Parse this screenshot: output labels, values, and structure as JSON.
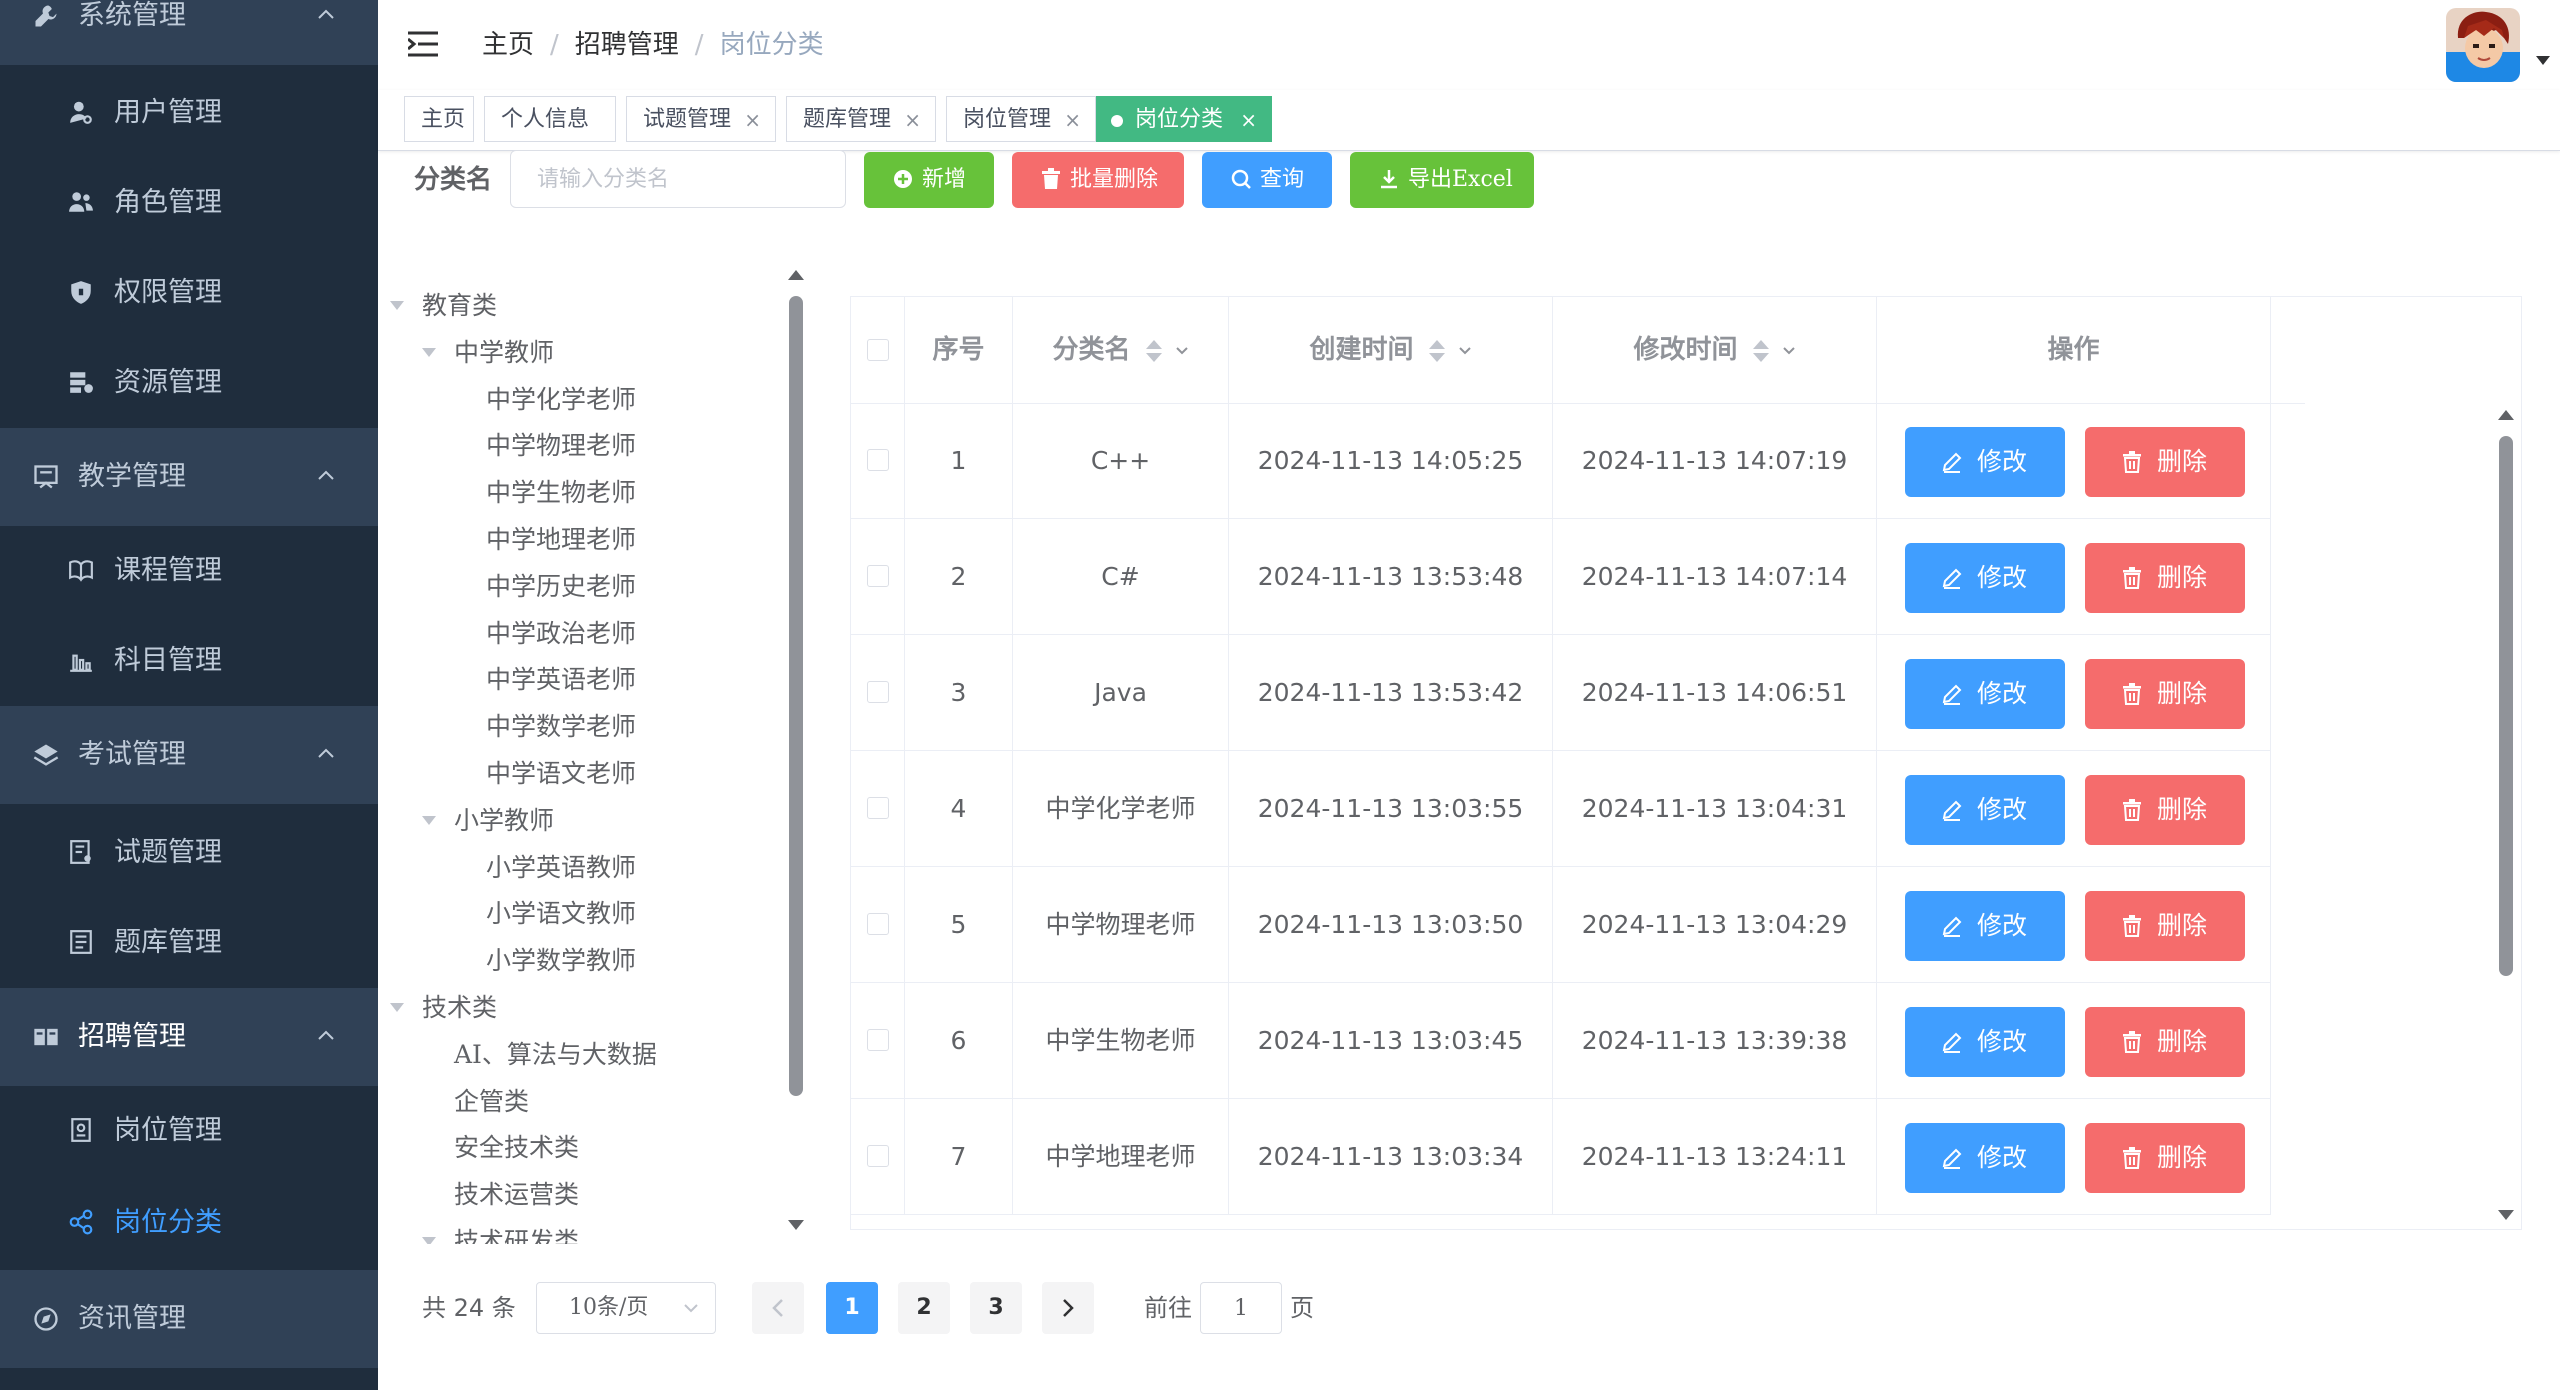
{
  "sidebar": {
    "groups": [
      {
        "label": "系统管理",
        "icon": "wrench-icon"
      },
      {
        "label": "教学管理",
        "icon": "book-icon"
      },
      {
        "label": "考试管理",
        "icon": "layers-icon"
      },
      {
        "label": "招聘管理",
        "icon": "recruit-icon"
      },
      {
        "label": "资讯管理",
        "icon": "compass-icon"
      }
    ],
    "items": [
      {
        "label": "用户管理",
        "icon": "user-icon"
      },
      {
        "label": "角色管理",
        "icon": "users-icon"
      },
      {
        "label": "权限管理",
        "icon": "shield-icon"
      },
      {
        "label": "资源管理",
        "icon": "resource-icon"
      },
      {
        "label": "课程管理",
        "icon": "course-icon"
      },
      {
        "label": "科目管理",
        "icon": "chart-icon"
      },
      {
        "label": "试题管理",
        "icon": "exam-doc-icon"
      },
      {
        "label": "题库管理",
        "icon": "bank-doc-icon"
      },
      {
        "label": "岗位管理",
        "icon": "position-icon"
      },
      {
        "label": "岗位分类",
        "icon": "share-icon"
      }
    ],
    "active_item": "岗位分类"
  },
  "header": {
    "breadcrumb": [
      "主页",
      "招聘管理",
      "岗位分类"
    ],
    "avatar": "avatar-image"
  },
  "tags": [
    {
      "label": "主页"
    },
    {
      "label": "个人信息"
    },
    {
      "label": "试题管理",
      "close": "×"
    },
    {
      "label": "题库管理",
      "close": "×"
    },
    {
      "label": "岗位管理",
      "close": "×"
    },
    {
      "label": "岗位分类",
      "close": "×",
      "active": true
    }
  ],
  "toolbar": {
    "filter_label": "分类名",
    "filter_placeholder": "请输入分类名",
    "filter_value": "",
    "add_label": "新增",
    "batch_delete_label": "批量删除",
    "query_label": "查询",
    "export_label": "导出Excel"
  },
  "tree": {
    "nodes": [
      {
        "label": "教育类",
        "level": 0,
        "expanded": true
      },
      {
        "label": "中学教师",
        "level": 1,
        "expanded": true
      },
      {
        "label": "中学化学老师",
        "level": 2
      },
      {
        "label": "中学物理老师",
        "level": 2
      },
      {
        "label": "中学生物老师",
        "level": 2
      },
      {
        "label": "中学地理老师",
        "level": 2
      },
      {
        "label": "中学历史老师",
        "level": 2
      },
      {
        "label": "中学政治老师",
        "level": 2
      },
      {
        "label": "中学英语老师",
        "level": 2
      },
      {
        "label": "中学数学老师",
        "level": 2
      },
      {
        "label": "中学语文老师",
        "level": 2
      },
      {
        "label": "小学教师",
        "level": 1,
        "expanded": true
      },
      {
        "label": "小学英语教师",
        "level": 2
      },
      {
        "label": "小学语文教师",
        "level": 2
      },
      {
        "label": "小学数学教师",
        "level": 2
      },
      {
        "label": "技术类",
        "level": 0,
        "expanded": true
      },
      {
        "label": "AI、算法与大数据",
        "level": 1
      },
      {
        "label": "企管类",
        "level": 1
      },
      {
        "label": "安全技术类",
        "level": 1
      },
      {
        "label": "技术运营类",
        "level": 1
      },
      {
        "label": "技术研发类",
        "level": 1,
        "expanded": true
      }
    ]
  },
  "table": {
    "columns": {
      "index": "序号",
      "name": "分类名",
      "created": "创建时间",
      "modified": "修改时间",
      "actions": "操作"
    },
    "edit_label": "修改",
    "delete_label": "删除",
    "rows": [
      {
        "index": "1",
        "name": "C++",
        "created": "2024-11-13 14:05:25",
        "modified": "2024-11-13 14:07:19"
      },
      {
        "index": "2",
        "name": "C#",
        "created": "2024-11-13 13:53:48",
        "modified": "2024-11-13 14:07:14"
      },
      {
        "index": "3",
        "name": "Java",
        "created": "2024-11-13 13:53:42",
        "modified": "2024-11-13 14:06:51"
      },
      {
        "index": "4",
        "name": "中学化学老师",
        "created": "2024-11-13 13:03:55",
        "modified": "2024-11-13 13:04:31"
      },
      {
        "index": "5",
        "name": "中学物理老师",
        "created": "2024-11-13 13:03:50",
        "modified": "2024-11-13 13:04:29"
      },
      {
        "index": "6",
        "name": "中学生物老师",
        "created": "2024-11-13 13:03:45",
        "modified": "2024-11-13 13:39:38"
      },
      {
        "index": "7",
        "name": "中学地理老师",
        "created": "2024-11-13 13:03:34",
        "modified": "2024-11-13 13:24:11"
      }
    ]
  },
  "pagination": {
    "total_text": "共 24 条",
    "page_size": "10条/页",
    "pages": [
      "1",
      "2",
      "3"
    ],
    "current_page": "1",
    "goto_label": "前往",
    "goto_value": "1",
    "goto_suffix": "页"
  },
  "colors": {
    "sidebar_bg": "#1f2d3d",
    "sidebar_group_bg": "#304156",
    "accent": "#409eff",
    "success": "#67c23a",
    "danger": "#f56c6c",
    "active_tag": "#42b983"
  }
}
